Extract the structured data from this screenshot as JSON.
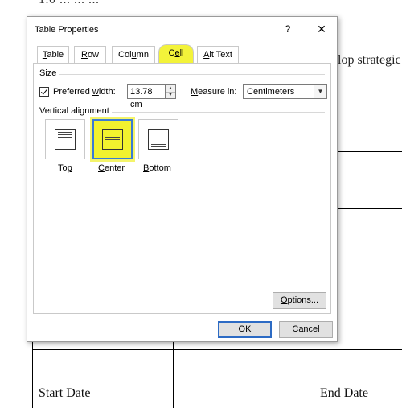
{
  "background_document": {
    "top_text": "1.0 ... ... ...",
    "right_text": "lop strategic",
    "cell_start_date": "Start Date",
    "cell_end_date": "End Date"
  },
  "dialog": {
    "title": "Table Properties",
    "help_glyph": "?",
    "close_glyph": "✕",
    "tabs": [
      {
        "label_pre": "",
        "accel": "T",
        "label_post": "able",
        "active": false
      },
      {
        "label_pre": "",
        "accel": "R",
        "label_post": "ow",
        "active": false
      },
      {
        "label_pre": "Col",
        "accel": "u",
        "label_post": "mn",
        "active": false
      },
      {
        "label_pre": "C",
        "accel": "e",
        "label_post": "ll",
        "active": true
      },
      {
        "label_pre": "",
        "accel": "A",
        "label_post": "lt Text",
        "active": false
      }
    ],
    "size": {
      "section_label": "Size",
      "preferred_width_pre": "Preferred ",
      "preferred_width_accel": "w",
      "preferred_width_post": "idth:",
      "preferred_width_checked": true,
      "width_value": "13.78 cm",
      "measure_in_accel": "M",
      "measure_in_post": "easure in:",
      "measure_in_value": "Centimeters"
    },
    "vertical_alignment": {
      "section_label": "Vertical alignment",
      "options": [
        {
          "label_pre": "To",
          "accel": "p",
          "label_post": "",
          "selected": false
        },
        {
          "label_pre": "",
          "accel": "C",
          "label_post": "enter",
          "selected": true
        },
        {
          "label_pre": "",
          "accel": "B",
          "label_post": "ottom",
          "selected": false
        }
      ]
    },
    "options_button": {
      "accel": "O",
      "label_post": "ptions..."
    },
    "ok_button": "OK",
    "cancel_button": "Cancel"
  },
  "colors": {
    "highlight": "#f3f33a",
    "selection_border": "#3a7bd5",
    "default_button_border": "#2d6bc4"
  }
}
